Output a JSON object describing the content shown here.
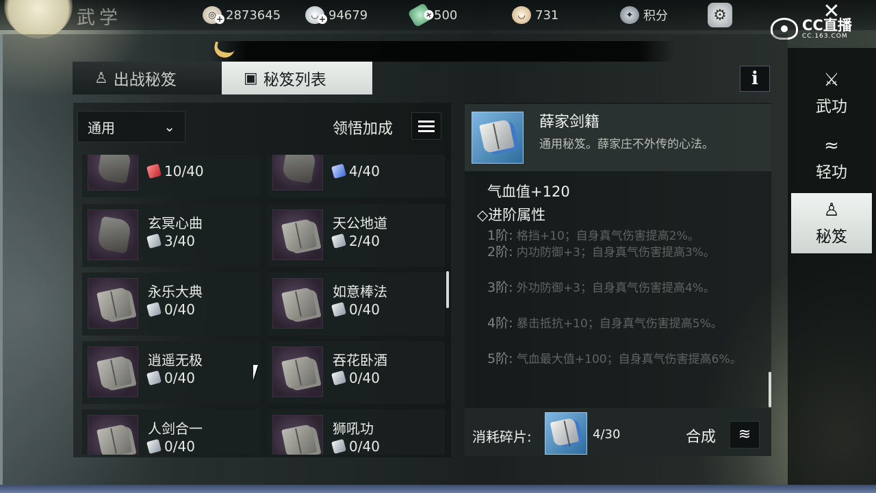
{
  "page_title": "武学",
  "resources": [
    {
      "icon": "coin-icon",
      "value": "2873645",
      "has_plus": true
    },
    {
      "icon": "silver-bowl-icon",
      "value": "94679",
      "has_plus": true
    },
    {
      "icon": "jade-icon",
      "value": "500",
      "has_plus": true
    },
    {
      "icon": "gold-bowl-icon",
      "value": "731",
      "has_plus": false
    },
    {
      "icon": "points-badge-icon",
      "value": "积分",
      "has_plus": false
    }
  ],
  "watermark": {
    "name": "CC直播",
    "url": "CC.163.COM"
  },
  "tabs": {
    "deploy": "出战秘笈",
    "list": "秘笈列表"
  },
  "filter": {
    "selected": "通用",
    "bonus_label": "领悟加成"
  },
  "cards": [
    {
      "name": "",
      "count": "10/40",
      "thumb": "scroll",
      "frag": "red"
    },
    {
      "name": "",
      "count": "4/40",
      "thumb": "scroll",
      "frag": "blue"
    },
    {
      "name": "玄冥心曲",
      "count": "3/40",
      "thumb": "scroll",
      "frag": "white"
    },
    {
      "name": "天公地道",
      "count": "2/40",
      "thumb": "book",
      "frag": "white"
    },
    {
      "name": "永乐大典",
      "count": "0/40",
      "thumb": "book",
      "frag": "white"
    },
    {
      "name": "如意棒法",
      "count": "0/40",
      "thumb": "book",
      "frag": "white"
    },
    {
      "name": "逍遥无极",
      "count": "0/40",
      "thumb": "book",
      "frag": "white"
    },
    {
      "name": "吞花卧酒",
      "count": "0/40",
      "thumb": "book",
      "frag": "white"
    },
    {
      "name": "人剑合一",
      "count": "0/40",
      "thumb": "book",
      "frag": "white"
    },
    {
      "name": "狮吼功",
      "count": "0/40",
      "thumb": "book",
      "frag": "white"
    }
  ],
  "detail": {
    "name": "薛家剑籍",
    "desc": "通用秘笈。薛家庄不外传的心法。",
    "stat": "气血值+120",
    "advance_title": "◇进阶属性",
    "tiers": [
      {
        "level": "1阶:",
        "text": "格挡+10；自身真气伤害提高2%。"
      },
      {
        "level": "2阶:",
        "text": "内功防御+3；自身真气伤害提高3%。"
      },
      {
        "level": "3阶:",
        "text": "外功防御+3；自身真气伤害提高4%。"
      },
      {
        "level": "4阶:",
        "text": "暴击抵抗+10；自身真气伤害提高5%。"
      },
      {
        "level": "5阶:",
        "text": "气血最大值+100；自身真气伤害提高6%。"
      }
    ],
    "cost_label": "消耗碎片:",
    "cost_count": "4/30",
    "synth_label": "合成"
  },
  "side_nav": [
    {
      "label": "武功",
      "icon": "martial-arts-icon",
      "active": false
    },
    {
      "label": "轻功",
      "icon": "lightness-skill-icon",
      "active": false
    },
    {
      "label": "秘笈",
      "icon": "meditation-icon",
      "active": true
    }
  ]
}
